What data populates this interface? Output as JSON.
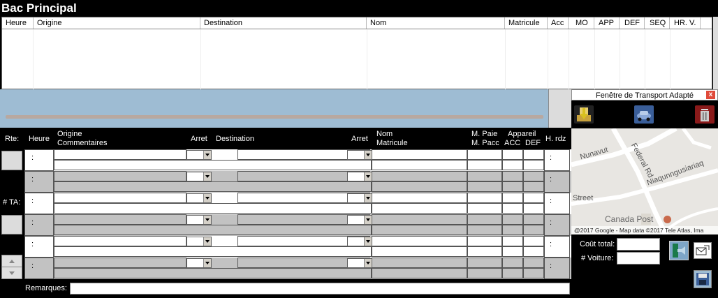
{
  "window": {
    "title": "Bac Principal"
  },
  "main_table": {
    "columns": [
      "Heure",
      "Origine",
      "Destination",
      "Nom",
      "Matricule",
      "Acc",
      "MO",
      "APP",
      "DEF",
      "SEQ",
      "HR. V."
    ]
  },
  "grid": {
    "headers": {
      "rte": "Rte:",
      "heure": "Heure",
      "origine": "Origine",
      "commentaires": "Commentaires",
      "arret1": "Arret",
      "destination": "Destination",
      "arret2": "Arret",
      "nom": "Nom",
      "matricule": "Matricule",
      "m_paie": "M. Paie",
      "m_pacc": "M. Pacc",
      "appareil": "Appareil",
      "acc": "ACC",
      "def": "DEF",
      "h_rdz": "H. rdz"
    },
    "ta_label": "# TA:",
    "time_placeholder": ":"
  },
  "remarks": {
    "label": "Remarques:"
  },
  "panel": {
    "title": "Fenêtre de Transport Adapté",
    "close": "x",
    "map": {
      "streets": [
        "Nunavut",
        "Federal Rd",
        "Niaqunngusiariaq",
        "Street"
      ],
      "place": "Canada Post",
      "attribution": "@2017 Google - Map data ©2017 Tele Atlas, Ima"
    },
    "cout_total_label": "Coût total:",
    "voiture_label": "# Voiture:"
  }
}
